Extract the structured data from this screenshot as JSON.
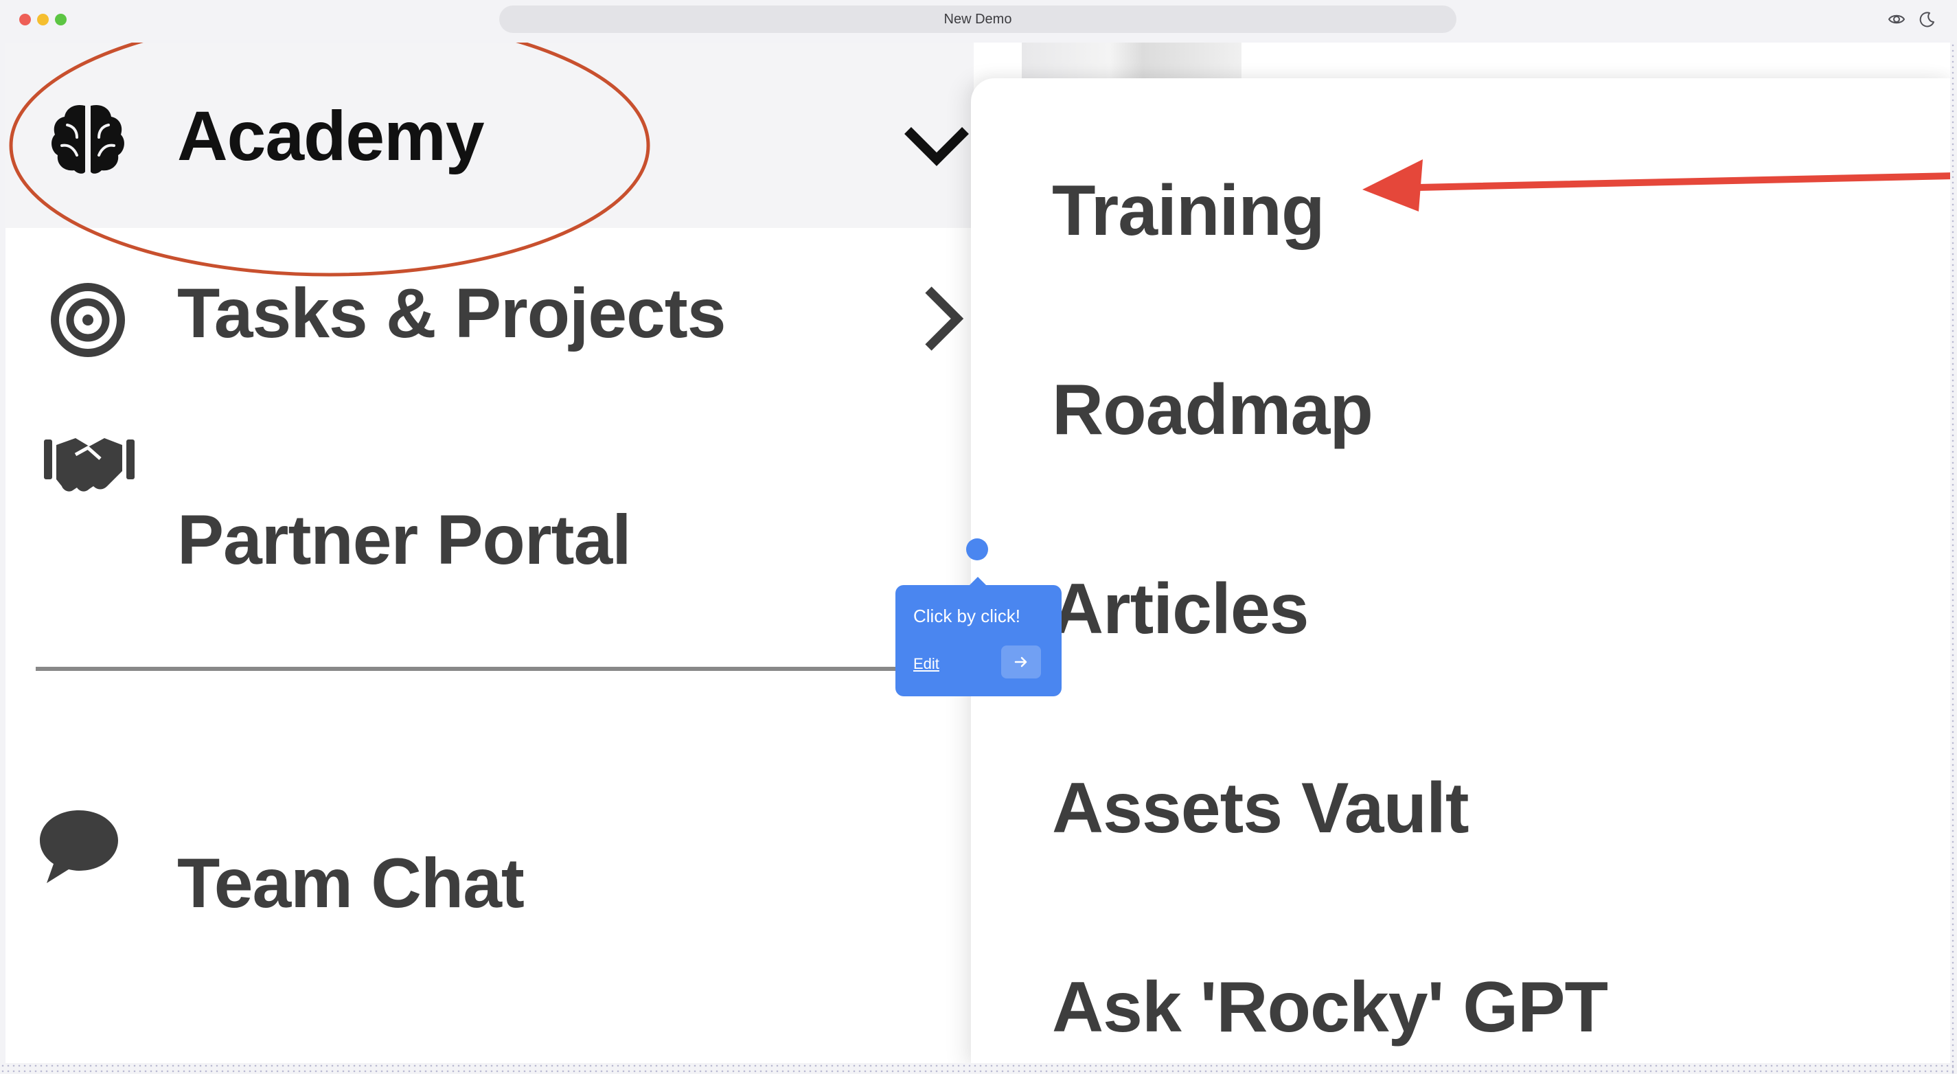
{
  "window": {
    "title": "New Demo",
    "icons": [
      "eye-icon",
      "moon-icon"
    ]
  },
  "nav": {
    "items": [
      {
        "label": "Academy",
        "icon": "brain-icon",
        "chevron": "chevron-down-icon",
        "highlighted": true
      },
      {
        "label": "Tasks & Projects",
        "icon": "target-icon",
        "chevron": "chevron-right-icon"
      },
      {
        "label": "Partner Portal",
        "icon": "handshake-icon"
      },
      {
        "label": "Team Chat",
        "icon": "chat-bubble-icon"
      }
    ]
  },
  "submenu": {
    "items": [
      {
        "label": "Training"
      },
      {
        "label": "Roadmap"
      },
      {
        "label": "Articles"
      },
      {
        "label": "Assets Vault"
      },
      {
        "label": "Ask 'Rocky' GPT"
      }
    ]
  },
  "tooltip": {
    "text": "Click by click!",
    "edit_label": "Edit",
    "next_icon": "arrow-right-icon",
    "color": "#4a86f0"
  },
  "annotations": {
    "circle_color": "#c8502e",
    "arrow_color": "#e5473a"
  }
}
